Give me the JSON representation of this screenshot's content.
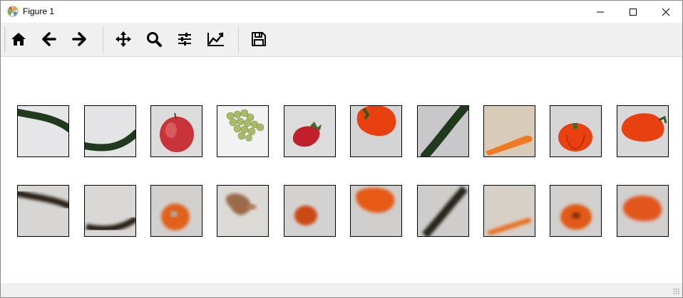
{
  "window": {
    "title": "Figure 1",
    "controls": [
      "minimize",
      "maximize",
      "close"
    ]
  },
  "toolbar": {
    "buttons": [
      {
        "name": "home",
        "icon": "home-icon"
      },
      {
        "name": "back",
        "icon": "arrow-left-icon"
      },
      {
        "name": "forward",
        "icon": "arrow-right-icon"
      },
      {
        "name": "pan",
        "icon": "move-icon"
      },
      {
        "name": "zoom",
        "icon": "magnifier-icon"
      },
      {
        "name": "configure-subplots",
        "icon": "sliders-icon"
      },
      {
        "name": "edit-axes",
        "icon": "line-chart-icon"
      },
      {
        "name": "save",
        "icon": "floppy-disk-icon"
      }
    ]
  },
  "figure": {
    "rows": 2,
    "cols": 10,
    "top_row": [
      "cucumber",
      "cucumber",
      "apple",
      "grapes",
      "strawberry",
      "bell-pepper",
      "cucumber",
      "carrot",
      "bell-pepper",
      "bell-pepper"
    ],
    "bottom_row_style": "blurred reconstruction",
    "colors": {
      "cucumber": "#1f3a1c",
      "apple": "#c8343a",
      "grapes": "#a9bb6a",
      "strawberry": "#c0202a",
      "pepper": "#e8410f",
      "carrot": "#f07a22",
      "background": "#dcdcdc"
    }
  }
}
